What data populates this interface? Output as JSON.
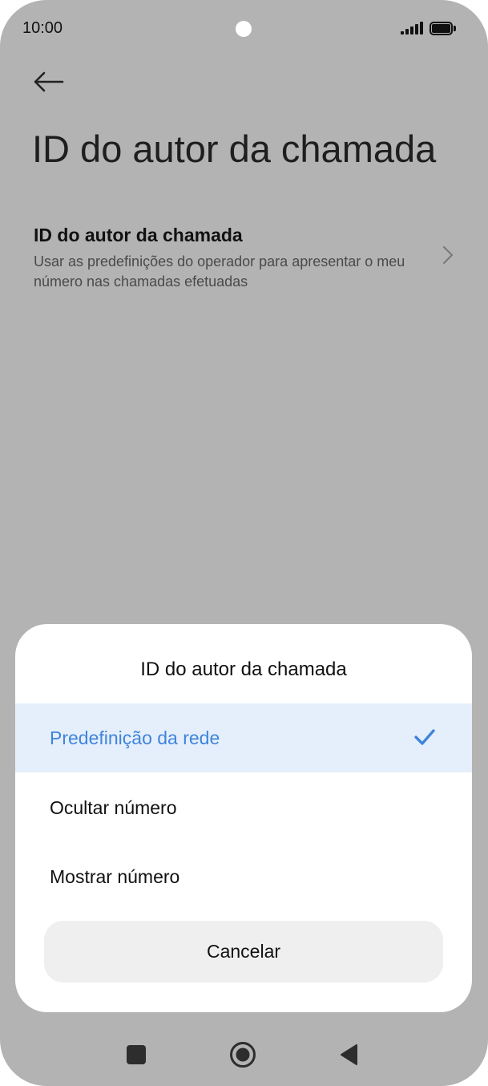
{
  "status_bar": {
    "time": "10:00"
  },
  "page": {
    "title": "ID do autor da chamada"
  },
  "setting": {
    "title": "ID do autor da chamada",
    "description": "Usar as predefinições do operador para apresentar o meu número nas chamadas efetuadas"
  },
  "dialog": {
    "title": "ID do autor da chamada",
    "options": [
      {
        "label": "Predefinição da rede",
        "selected": true
      },
      {
        "label": "Ocultar número",
        "selected": false
      },
      {
        "label": "Mostrar número",
        "selected": false
      }
    ],
    "cancel_label": "Cancelar"
  },
  "colors": {
    "accent": "#3f84dc",
    "selected_background": "#e5effb",
    "scrim_background": "#b3b3b3"
  },
  "icons": {
    "back": "arrow-left",
    "chevron": "chevron-right",
    "check": "checkmark",
    "nav": [
      "recent-apps-square",
      "home-circle",
      "back-triangle"
    ]
  }
}
